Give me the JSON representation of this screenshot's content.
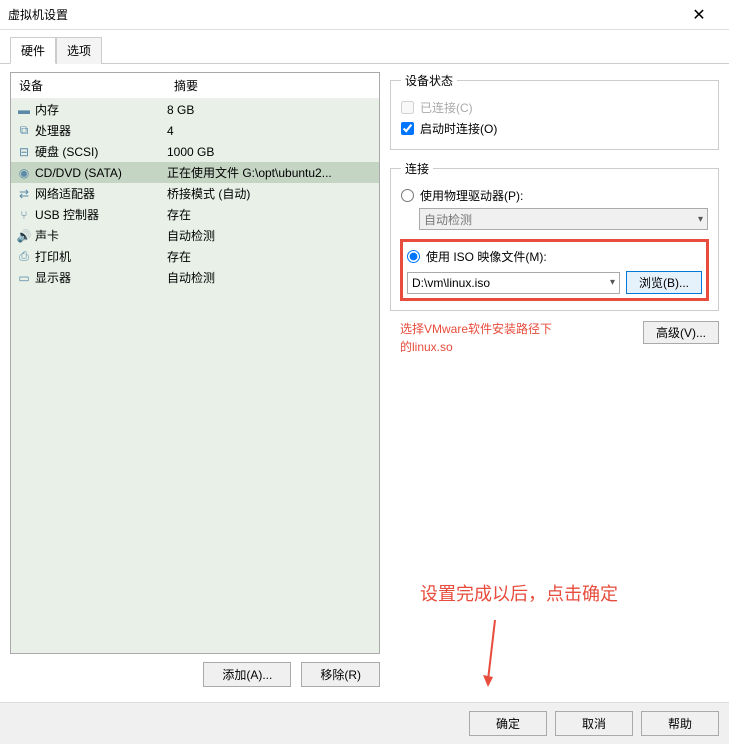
{
  "window": {
    "title": "虚拟机设置"
  },
  "tabs": {
    "hardware": "硬件",
    "options": "选项"
  },
  "list": {
    "header_device": "设备",
    "header_summary": "摘要",
    "rows": [
      {
        "icon": "memory",
        "name": "内存",
        "summary": "8 GB"
      },
      {
        "icon": "cpu",
        "name": "处理器",
        "summary": "4"
      },
      {
        "icon": "disk",
        "name": "硬盘 (SCSI)",
        "summary": "1000 GB"
      },
      {
        "icon": "cd",
        "name": "CD/DVD (SATA)",
        "summary": "正在使用文件 G:\\opt\\ubuntu2..."
      },
      {
        "icon": "net",
        "name": "网络适配器",
        "summary": "桥接模式 (自动)"
      },
      {
        "icon": "usb",
        "name": "USB 控制器",
        "summary": "存在"
      },
      {
        "icon": "sound",
        "name": "声卡",
        "summary": "自动检测"
      },
      {
        "icon": "printer",
        "name": "打印机",
        "summary": "存在"
      },
      {
        "icon": "display",
        "name": "显示器",
        "summary": "自动检测"
      }
    ]
  },
  "buttons": {
    "add": "添加(A)...",
    "remove": "移除(R)",
    "browse": "浏览(B)...",
    "advanced": "高级(V)...",
    "ok": "确定",
    "cancel": "取消",
    "help": "帮助"
  },
  "status": {
    "legend": "设备状态",
    "connected": "已连接(C)",
    "connect_on_start": "启动时连接(O)"
  },
  "connection": {
    "legend": "连接",
    "physical": "使用物理驱动器(P):",
    "autodetect": "自动检测",
    "use_iso": "使用 ISO 映像文件(M):",
    "iso_path": "D:\\vm\\linux.iso"
  },
  "annotations": {
    "line1": "选择VMware软件安装路径下",
    "line2": "的linux.so",
    "line3": "设置完成以后，点击确定"
  }
}
